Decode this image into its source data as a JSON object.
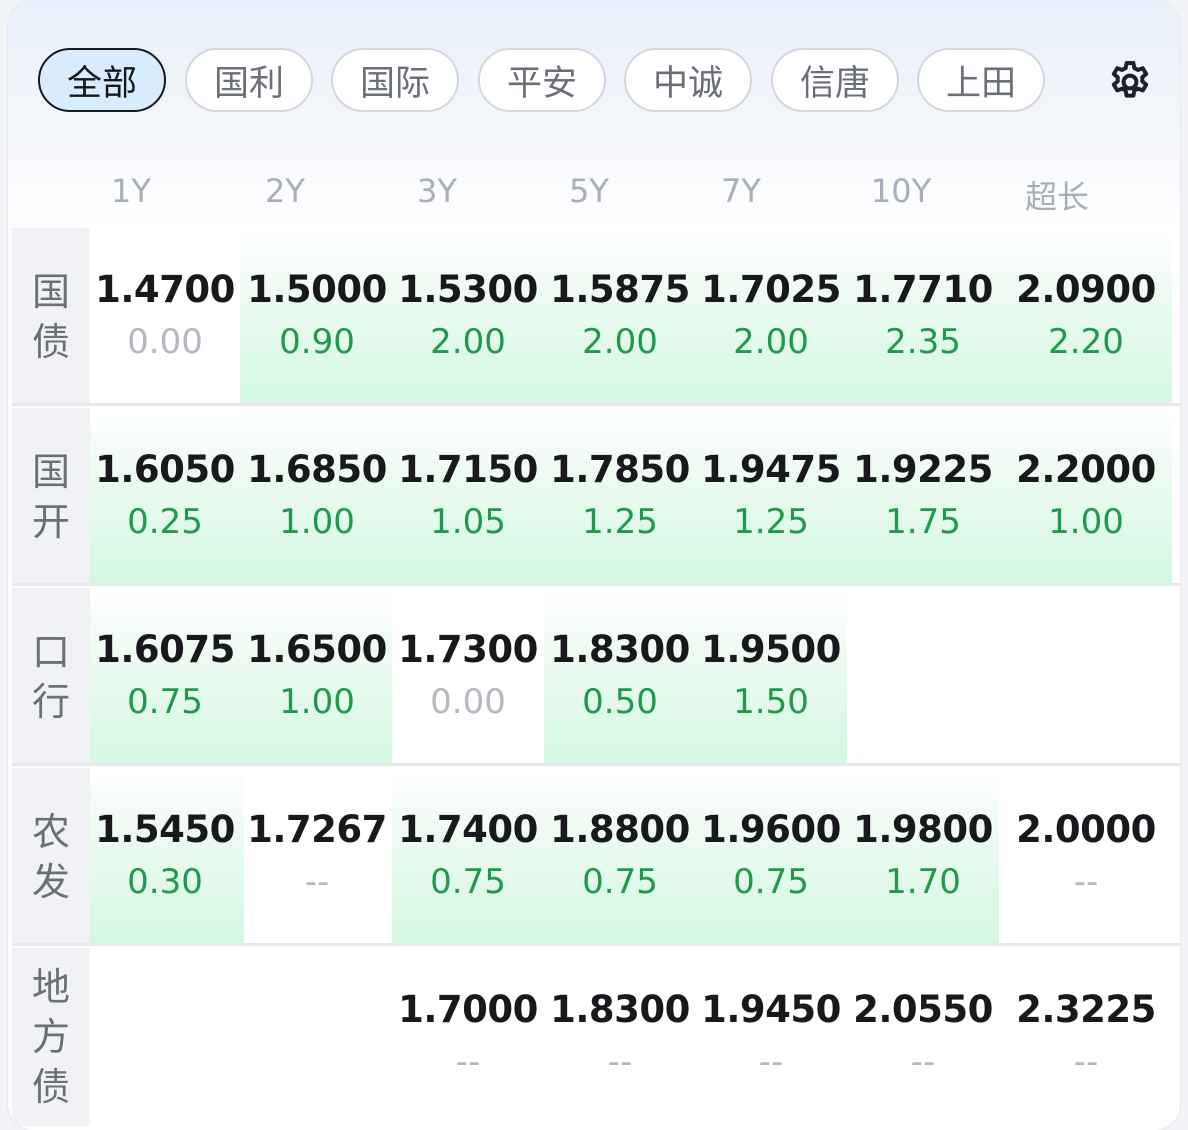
{
  "tabs": [
    {
      "label": "全部",
      "active": true
    },
    {
      "label": "国利",
      "active": false
    },
    {
      "label": "国际",
      "active": false
    },
    {
      "label": "平安",
      "active": false
    },
    {
      "label": "中诚",
      "active": false
    },
    {
      "label": "信唐",
      "active": false
    },
    {
      "label": "上田",
      "active": false
    }
  ],
  "settings_icon": "gear-icon",
  "columns": [
    "1Y",
    "2Y",
    "3Y",
    "5Y",
    "7Y",
    "10Y",
    "超长"
  ],
  "colors": {
    "positive": "#1f9a4c",
    "zero": "#b3b8c2",
    "highlight": "#d3f8e1",
    "active_tab": "#d8ebff"
  },
  "rows": [
    {
      "label": [
        "国",
        "债"
      ],
      "cells": [
        {
          "value": "1.4700",
          "change": "0.00",
          "highlight": false
        },
        {
          "value": "1.5000",
          "change": "0.90",
          "highlight": true
        },
        {
          "value": "1.5300",
          "change": "2.00",
          "highlight": true
        },
        {
          "value": "1.5875",
          "change": "2.00",
          "highlight": true
        },
        {
          "value": "1.7025",
          "change": "2.00",
          "highlight": true
        },
        {
          "value": "1.7710",
          "change": "2.35",
          "highlight": true
        },
        {
          "value": "2.0900",
          "change": "2.20",
          "highlight": true
        }
      ]
    },
    {
      "label": [
        "国",
        "开"
      ],
      "cells": [
        {
          "value": "1.6050",
          "change": "0.25",
          "highlight": true
        },
        {
          "value": "1.6850",
          "change": "1.00",
          "highlight": true
        },
        {
          "value": "1.7150",
          "change": "1.05",
          "highlight": true
        },
        {
          "value": "1.7850",
          "change": "1.25",
          "highlight": true
        },
        {
          "value": "1.9475",
          "change": "1.25",
          "highlight": true
        },
        {
          "value": "1.9225",
          "change": "1.75",
          "highlight": true
        },
        {
          "value": "2.2000",
          "change": "1.00",
          "highlight": true
        }
      ]
    },
    {
      "label": [
        "口",
        "行"
      ],
      "cells": [
        {
          "value": "1.6075",
          "change": "0.75",
          "highlight": true
        },
        {
          "value": "1.6500",
          "change": "1.00",
          "highlight": true
        },
        {
          "value": "1.7300",
          "change": "0.00",
          "highlight": false
        },
        {
          "value": "1.8300",
          "change": "0.50",
          "highlight": true
        },
        {
          "value": "1.9500",
          "change": "1.50",
          "highlight": true
        },
        {
          "value": "",
          "change": "",
          "highlight": false
        },
        {
          "value": "",
          "change": "",
          "highlight": false
        }
      ]
    },
    {
      "label": [
        "农",
        "发"
      ],
      "cells": [
        {
          "value": "1.5450",
          "change": "0.30",
          "highlight": true
        },
        {
          "value": "1.7267",
          "change": "--",
          "highlight": false
        },
        {
          "value": "1.7400",
          "change": "0.75",
          "highlight": true
        },
        {
          "value": "1.8800",
          "change": "0.75",
          "highlight": true
        },
        {
          "value": "1.9600",
          "change": "0.75",
          "highlight": true
        },
        {
          "value": "1.9800",
          "change": "1.70",
          "highlight": true
        },
        {
          "value": "2.0000",
          "change": "--",
          "highlight": false
        }
      ]
    },
    {
      "label": [
        "地",
        "方",
        "债"
      ],
      "cells": [
        {
          "value": "",
          "change": "",
          "highlight": false
        },
        {
          "value": "",
          "change": "",
          "highlight": false
        },
        {
          "value": "1.7000",
          "change": "--",
          "highlight": false
        },
        {
          "value": "1.8300",
          "change": "--",
          "highlight": false
        },
        {
          "value": "1.9450",
          "change": "--",
          "highlight": false
        },
        {
          "value": "2.0550",
          "change": "--",
          "highlight": false
        },
        {
          "value": "2.3225",
          "change": "--",
          "highlight": false
        }
      ]
    }
  ]
}
